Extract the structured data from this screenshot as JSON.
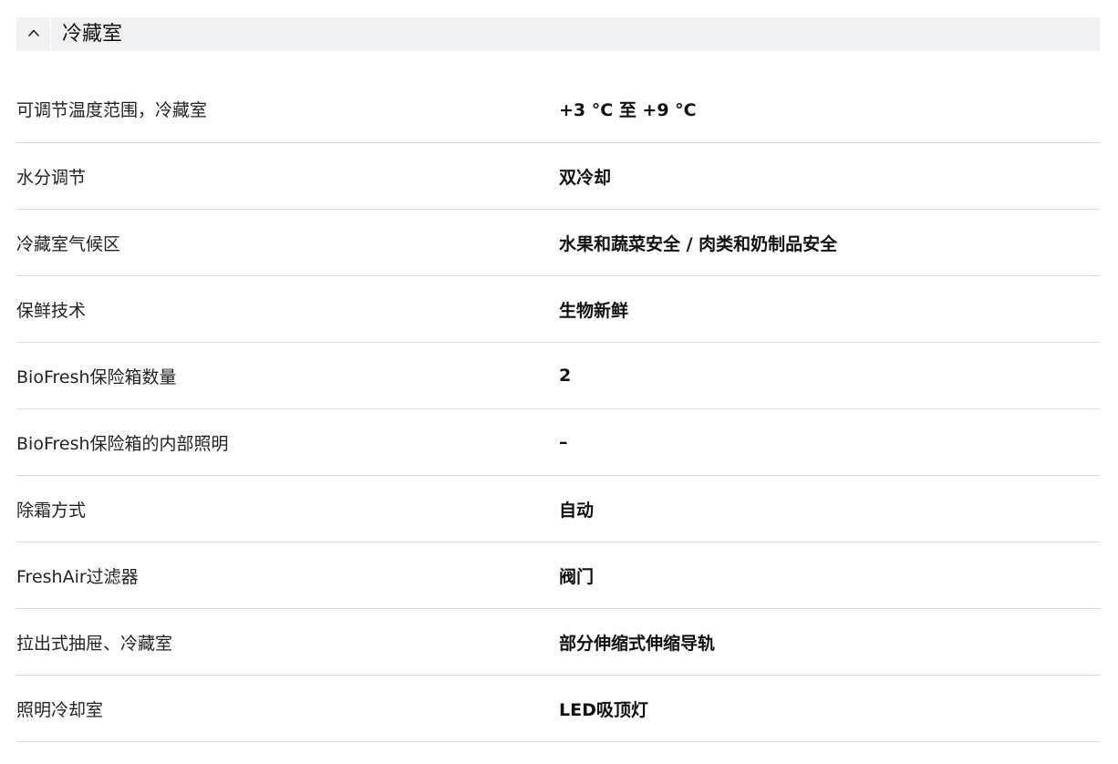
{
  "section": {
    "title": "冷藏室",
    "toggle_icon": "chevron-up-icon",
    "expanded": true
  },
  "specs": [
    {
      "label": "可调节温度范围，冷藏室",
      "value": "+3 °C 至 +9 °C"
    },
    {
      "label": "水分调节",
      "value": "双冷却"
    },
    {
      "label": "冷藏室气候区",
      "value": "水果和蔬菜安全 / 肉类和奶制品安全"
    },
    {
      "label": "保鲜技术",
      "value": "生物新鲜"
    },
    {
      "label": "BioFresh保险箱数量",
      "value": "2"
    },
    {
      "label": "BioFresh保险箱的内部照明",
      "value": "–"
    },
    {
      "label": "除霜方式",
      "value": "自动"
    },
    {
      "label": "FreshAir过滤器",
      "value": "阀门"
    },
    {
      "label": "拉出式抽屉、冷藏室",
      "value": "部分伸缩式伸缩导轨"
    },
    {
      "label": "照明冷却室",
      "value": "LED吸顶灯"
    }
  ],
  "colors": {
    "header_bg": "#eff1f3",
    "divider": "#dcdcdc",
    "text": "#111111"
  }
}
